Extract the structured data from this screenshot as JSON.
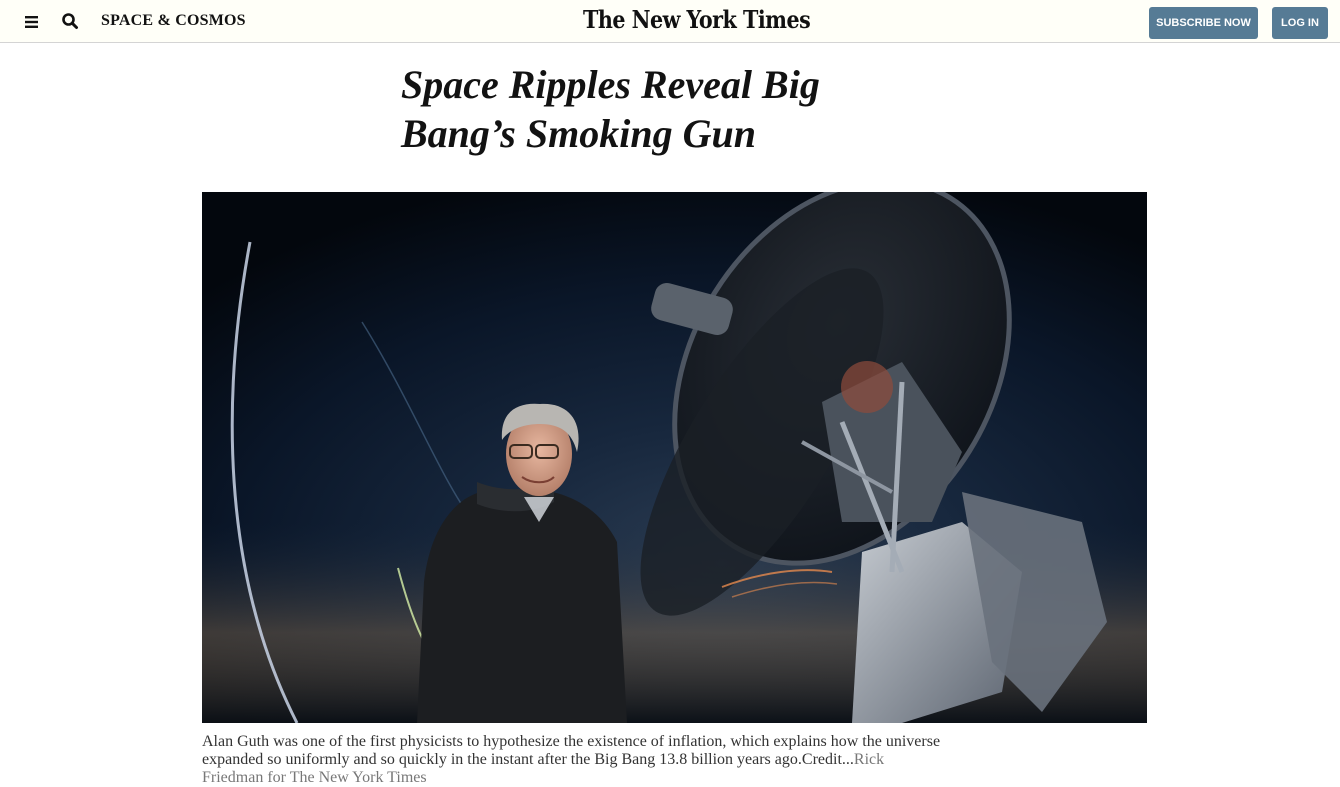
{
  "header": {
    "section_label": "SPACE & COSMOS",
    "logo_text": "The New York Times",
    "subscribe_label": "SUBSCRIBE NOW",
    "login_label": "LOG IN",
    "menu_icon": "hamburger-menu-icon",
    "search_icon": "search-icon",
    "button_color": "#567b95"
  },
  "article": {
    "headline": "Space Ripples Reveal Big Bang’s Smoking Gun",
    "photo": {
      "description_icon": "telescope-portrait-photo"
    },
    "caption": "Alan Guth was one of the first physicists to hypothesize the existence of inflation, which explains how the universe expanded so uniformly and so quickly in the instant after the Big Bang 13.8 billion years ago.",
    "credit_label": "Credit...",
    "credit_name": "Rick Friedman for The New York Times"
  }
}
